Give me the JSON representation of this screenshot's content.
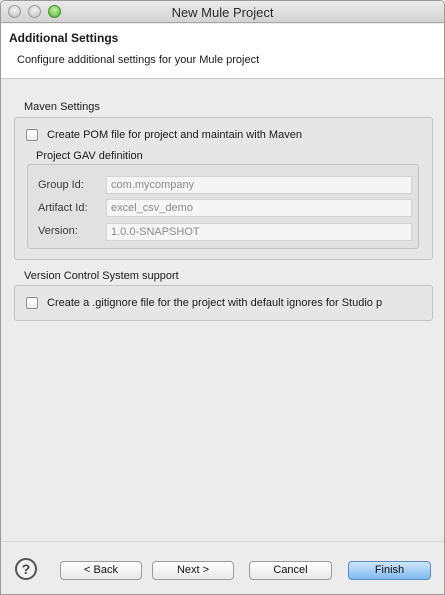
{
  "window": {
    "title": "New Mule Project"
  },
  "banner": {
    "title": "Additional Settings",
    "subtitle": "Configure additional settings for your Mule project"
  },
  "maven": {
    "group_label": "Maven Settings",
    "create_pom_label": "Create POM file for project and maintain with Maven",
    "create_pom_checked": false,
    "gav": {
      "label": "Project GAV definition",
      "group_id_label": "Group Id:",
      "group_id_value": "com.mycompany",
      "artifact_id_label": "Artifact Id:",
      "artifact_id_value": "excel_csv_demo",
      "version_label": "Version:",
      "version_value": "1.0.0-SNAPSHOT"
    }
  },
  "vcs": {
    "group_label": "Version Control System support",
    "gitignore_label": "Create a .gitignore file for the project with default ignores for Studio p",
    "gitignore_checked": false
  },
  "footer": {
    "help_glyph": "?",
    "back_label": "< Back",
    "next_label": "Next >",
    "cancel_label": "Cancel",
    "finish_label": "Finish"
  }
}
